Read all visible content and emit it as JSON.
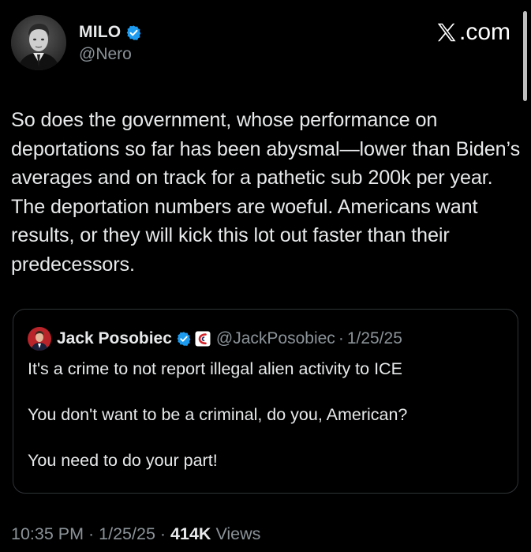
{
  "author": {
    "name": "MILO",
    "handle": "@Nero",
    "verified": true
  },
  "brand": {
    "label": ".com",
    "icon": "x-logo-icon"
  },
  "tweet": {
    "text": "So does the government, whose performance on deportations so far has been abysmal—lower than Biden’s averages and on track for a pathetic sub 200k per year. The deportation numbers are woeful. Americans want results, or they will kick this lot out faster than their predecessors."
  },
  "quote": {
    "name": "Jack Posobiec",
    "handle": "@JackPosobiec",
    "separator": "·",
    "date": "1/25/25",
    "verified": true,
    "affiliate_badge": "affiliate-badge-icon",
    "paragraphs": [
      "It's a crime to not report illegal alien activity to ICE",
      "You don't want to be a criminal, do you, American?",
      "You need to do your part!"
    ]
  },
  "meta": {
    "time": "10:35 PM",
    "sep1": "·",
    "date": "1/25/25",
    "sep2": "·",
    "views_count": "414K",
    "views_label": "Views"
  },
  "colors": {
    "background": "#000000",
    "text": "#e7e9ea",
    "muted": "#8b9399",
    "verified_blue": "#1d9bf0",
    "border": "#2f3336"
  }
}
